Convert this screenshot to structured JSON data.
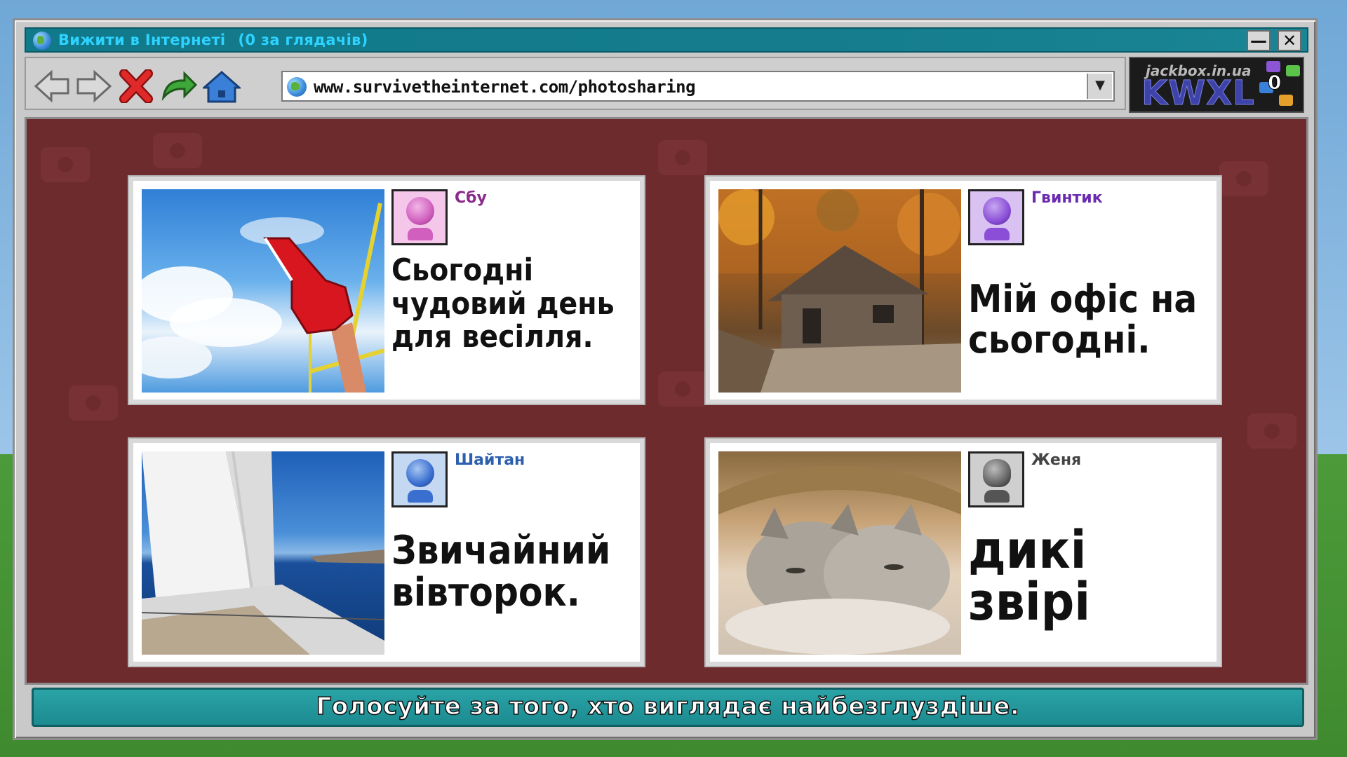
{
  "window": {
    "title": "Вижити в Інтернеті",
    "viewers": "(0 за глядачів)",
    "minimize_glyph": "—",
    "close_glyph": "✕"
  },
  "toolbar": {
    "buttons": [
      "back-arrow-icon",
      "forward-arrow-icon",
      "stop-x-icon",
      "refresh-arrow-icon",
      "home-icon"
    ],
    "url": "www.survivetheinternet.com/photosharing",
    "dropdown_glyph": "▼"
  },
  "logo": {
    "site": "jackbox.in.ua",
    "brand": "KWXL",
    "count": "0"
  },
  "posts": [
    {
      "player": "Сбу",
      "player_color": "#8b2a8c",
      "avatar_color": "#d879c8",
      "avatar_bg": "#f3c6ea",
      "caption": "Сьогодні чудовий день для весілля.",
      "photo": "foam-finger-sky"
    },
    {
      "player": "Гвинтик",
      "player_color": "#6b2bb0",
      "avatar_color": "#8a4fd6",
      "avatar_bg": "#d9c2f2",
      "caption": "Мій офіс на сьогодні.",
      "photo": "log-cabin-autumn"
    },
    {
      "player": "Шайтан",
      "player_color": "#2c5fae",
      "avatar_color": "#3a6fd0",
      "avatar_bg": "#c4d8f2",
      "caption": "Звичайний вівторок.",
      "photo": "sailboat-sea"
    },
    {
      "player": "Женя",
      "player_color": "#444444",
      "avatar_color": "#666666",
      "avatar_bg": "#cfcfcf",
      "caption": "дикі звірі",
      "photo": "kittens-basket"
    }
  ],
  "instruction": "Голосуйте за того, хто виглядає найбезглуздіше."
}
